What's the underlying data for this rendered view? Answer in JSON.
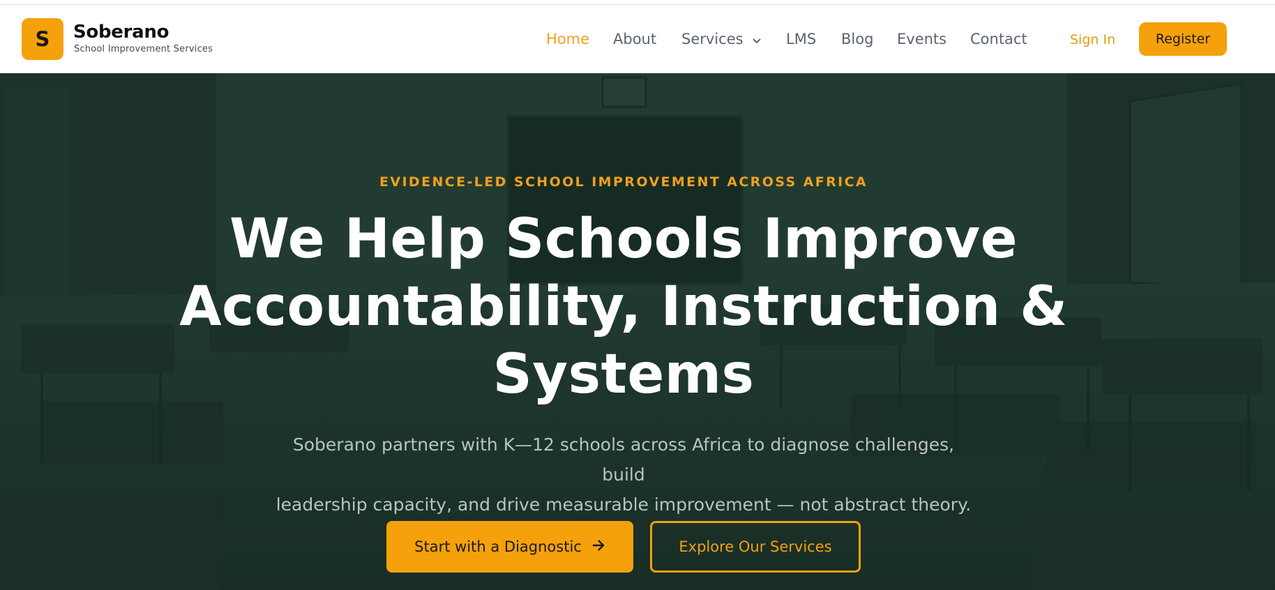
{
  "brand": {
    "logo_letter": "S",
    "name": "Soberano",
    "tagline": "School Improvement Services"
  },
  "nav": {
    "items": [
      {
        "label": "Home",
        "active": true
      },
      {
        "label": "About"
      },
      {
        "label": "Services",
        "has_dropdown": true
      },
      {
        "label": "LMS"
      },
      {
        "label": "Blog"
      },
      {
        "label": "Events"
      },
      {
        "label": "Contact"
      }
    ],
    "sign_in": "Sign In",
    "register": "Register"
  },
  "hero": {
    "eyebrow": "EVIDENCE-LED SCHOOL IMPROVEMENT ACROSS AFRICA",
    "headline_line1": "We Help Schools Improve",
    "headline_line2": "Accountability, Instruction &",
    "headline_line3": "Systems",
    "subtext_line1": "Soberano partners with K—12 schools across Africa to diagnose challenges, build",
    "subtext_line2": "leadership capacity, and drive measurable improvement — not abstract theory.",
    "cta_primary": "Start with a Diagnostic",
    "cta_secondary": "Explore Our Services"
  },
  "colors": {
    "accent": "#f4a10b",
    "hero_overlay": "#223a31",
    "nav_text": "#5b6372"
  },
  "icons": {
    "services_dropdown": "chevron-down-icon",
    "cta_arrow": "arrow-right-icon"
  }
}
